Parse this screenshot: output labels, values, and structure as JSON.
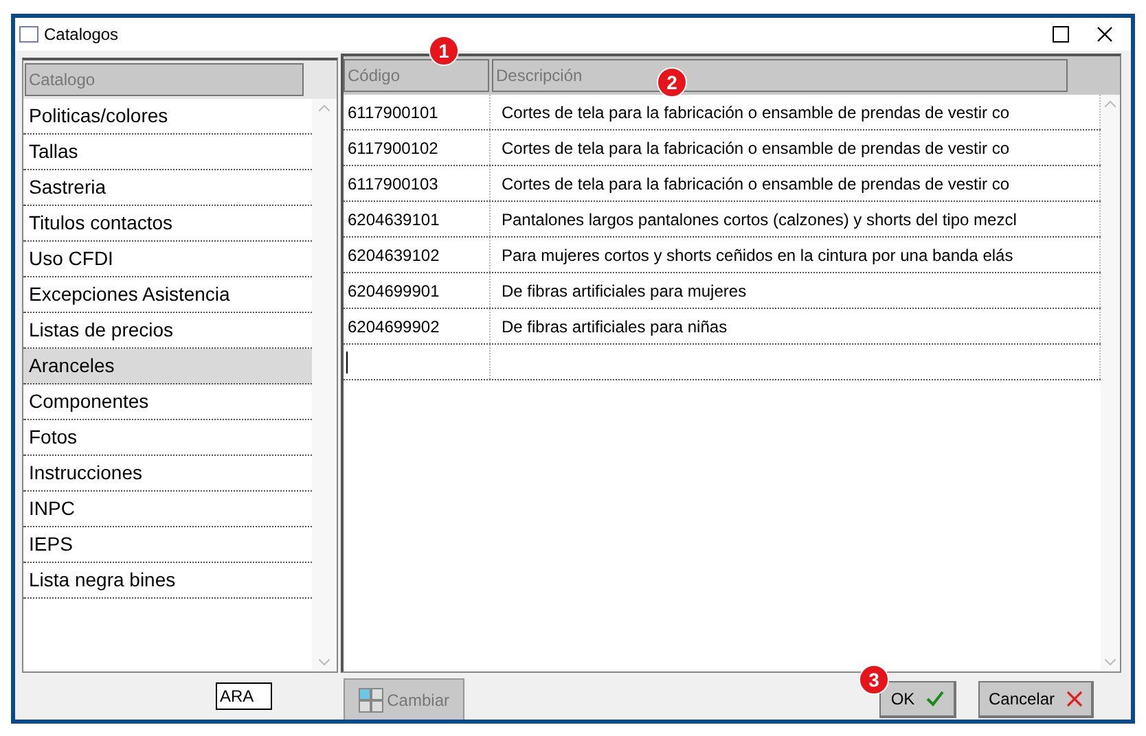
{
  "window": {
    "title": "Catalogos"
  },
  "catalog_list": {
    "header": "Catalogo",
    "items": [
      {
        "label": "Politicas/colores",
        "selected": false
      },
      {
        "label": "Tallas",
        "selected": false
      },
      {
        "label": "Sastreria",
        "selected": false
      },
      {
        "label": "Titulos contactos",
        "selected": false
      },
      {
        "label": "Uso CFDI",
        "selected": false
      },
      {
        "label": "Excepciones Asistencia",
        "selected": false
      },
      {
        "label": "Listas de precios",
        "selected": false
      },
      {
        "label": "Aranceles",
        "selected": true
      },
      {
        "label": "Componentes",
        "selected": false
      },
      {
        "label": "Fotos",
        "selected": false
      },
      {
        "label": "Instrucciones",
        "selected": false
      },
      {
        "label": "INPC",
        "selected": false
      },
      {
        "label": "IEPS",
        "selected": false
      },
      {
        "label": "Lista negra bines",
        "selected": false
      }
    ]
  },
  "table": {
    "columns": [
      "Código",
      "Descripción"
    ],
    "rows": [
      [
        "6117900101",
        "Cortes de tela para la fabricación o ensamble de prendas de vestir co"
      ],
      [
        "6117900102",
        "Cortes de tela para la fabricación o ensamble de prendas de vestir co"
      ],
      [
        "6117900103",
        "Cortes de tela para la fabricación o ensamble de prendas de vestir co"
      ],
      [
        "6204639101",
        "Pantalones largos pantalones cortos (calzones) y shorts del tipo mezcl"
      ],
      [
        "6204639102",
        "Para mujeres cortos y shorts ceñidos en la cintura por una banda elás"
      ],
      [
        "6204699901",
        "De fibras artificiales para mujeres"
      ],
      [
        "6204699902",
        "De fibras artificiales para niñas"
      ]
    ]
  },
  "search_field": {
    "value": "ARA"
  },
  "buttons": [
    {
      "label": "Cambiar",
      "kind": "change",
      "disabled": true
    },
    {
      "label": "OK",
      "kind": "ok",
      "disabled": false
    },
    {
      "label": "Cancelar",
      "kind": "cancel",
      "disabled": false
    }
  ],
  "annotations": [
    "1",
    "2",
    "3"
  ]
}
